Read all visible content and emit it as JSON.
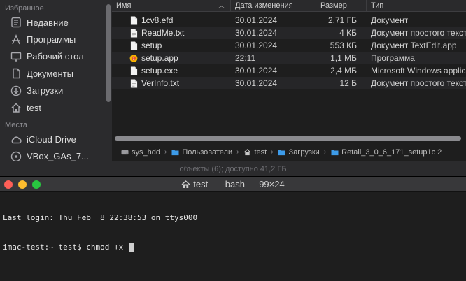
{
  "finder": {
    "sidebar": {
      "favorites_header": "Избранное",
      "favorites": [
        {
          "label": "Недавние",
          "icon": "clock-icon"
        },
        {
          "label": "Программы",
          "icon": "applications-icon"
        },
        {
          "label": "Рабочий стол",
          "icon": "desktop-icon"
        },
        {
          "label": "Документы",
          "icon": "documents-icon"
        },
        {
          "label": "Загрузки",
          "icon": "downloads-icon"
        },
        {
          "label": "test",
          "icon": "home-icon"
        }
      ],
      "places_header": "Места",
      "places": [
        {
          "label": "iCloud Drive",
          "icon": "icloud-icon"
        },
        {
          "label": "VBox_GAs_7...",
          "icon": "disk-icon"
        }
      ]
    },
    "columns": {
      "name": "Имя",
      "date": "Дата изменения",
      "size": "Размер",
      "type": "Тип"
    },
    "files": [
      {
        "name": "1cv8.efd",
        "date": "30.01.2024",
        "size": "2,71 ГБ",
        "type": "Документ",
        "icon": "document-icon"
      },
      {
        "name": "ReadMe.txt",
        "date": "30.01.2024",
        "size": "4 КБ",
        "type": "Документ простого текста",
        "icon": "text-document-icon"
      },
      {
        "name": "setup",
        "date": "30.01.2024",
        "size": "553 КБ",
        "type": "Документ TextEdit.app",
        "icon": "document-icon"
      },
      {
        "name": "setup.app",
        "date": "22:11",
        "size": "1,1 МБ",
        "type": "Программа",
        "icon": "app-icon"
      },
      {
        "name": "setup.exe",
        "date": "30.01.2024",
        "size": "2,4 МБ",
        "type": "Microsoft Windows application",
        "icon": "document-icon"
      },
      {
        "name": "VerInfo.txt",
        "date": "30.01.2024",
        "size": "12 Б",
        "type": "Документ простого текста",
        "icon": "text-document-icon"
      }
    ],
    "path": [
      {
        "label": "sys_hdd",
        "icon": "drive-icon"
      },
      {
        "label": "Пользователи",
        "icon": "folder-icon"
      },
      {
        "label": "test",
        "icon": "home-icon"
      },
      {
        "label": "Загрузки",
        "icon": "folder-icon"
      },
      {
        "label": "Retail_3_0_6_171_setup1c 2",
        "icon": "folder-icon"
      }
    ],
    "status": "объекты (6); доступно 41,2 ГБ"
  },
  "terminal": {
    "title": "test — -bash — 99×24",
    "lines": [
      "Last login: Thu Feb  8 22:38:53 on ttys000",
      "imac-test:~ test$ chmod +x "
    ]
  },
  "colors": {
    "close": "#ff5f57",
    "minimize": "#febc2e",
    "zoom": "#28c840",
    "folder": "#3d9be9"
  }
}
